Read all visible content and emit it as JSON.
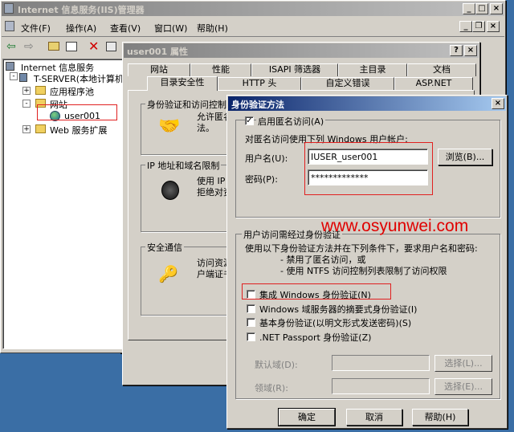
{
  "iis": {
    "title": "Internet 信息服务(IIS)管理器",
    "menu": [
      "文件(F)",
      "操作(A)",
      "查看(V)",
      "窗口(W)",
      "帮助(H)"
    ],
    "tree": {
      "root": "Internet 信息服务",
      "server": "T-SERVER(本地计算机",
      "app_pool": "应用程序池",
      "websites": "网站",
      "site": "user001",
      "web_ext": "Web 服务扩展"
    }
  },
  "props": {
    "title": "user001 属性",
    "tabs_row1": [
      "网站",
      "性能",
      "ISAPI 筛选器",
      "主目录",
      "文档"
    ],
    "tabs_row2": [
      "目录安全性",
      "HTTP 头",
      "自定义错误",
      "ASP.NET"
    ],
    "auth_group": "身份验证和访问控制",
    "auth_desc": "允许匿名\n法。",
    "ip_group": "IP 地址和域名限制",
    "ip_desc": "使用 IP\n拒绝对资",
    "ssl_group": "安全通信",
    "ssl_desc": "访问资源\n户端证书"
  },
  "auth": {
    "title": "身份验证方法",
    "enable_anon": "启用匿名访问(A)",
    "anon_desc": "对匿名访问使用下列 Windows 用户帐户:",
    "username_label": "用户名(U):",
    "username_value": "IUSER_user001",
    "password_label": "密码(P):",
    "password_value": "*************",
    "browse": "浏览(B)...",
    "auth_group": "用户访问需经过身份验证",
    "auth_desc1": "使用以下身份验证方法并在下列条件下，要求用户名和密码:",
    "auth_desc2": "- 禁用了匿名访问，或",
    "auth_desc3": "- 使用 NTFS 访问控制列表限制了访问权限",
    "integrated": "集成 Windows 身份验证(N)",
    "digest": "Windows 域服务器的摘要式身份验证(I)",
    "basic": "基本身份验证(以明文形式发送密码)(S)",
    "passport": ".NET Passport 身份验证(Z)",
    "default_domain": "默认域(D):",
    "realm": "领域(R):",
    "select1": "选择(L)...",
    "select2": "选择(E)...",
    "ok": "确定",
    "cancel": "取消",
    "help": "帮助(H)"
  },
  "watermark": "www.osyunwei.com",
  "colors": {
    "watermark": "#e00000",
    "highlight": "#e02020"
  }
}
